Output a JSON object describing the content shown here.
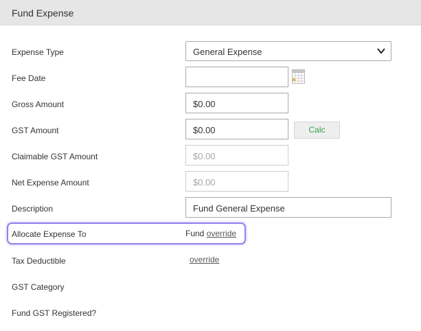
{
  "header": {
    "title": "Fund Expense"
  },
  "fields": {
    "expense_type": {
      "label": "Expense Type",
      "value": "General Expense"
    },
    "fee_date": {
      "label": "Fee Date",
      "value": ""
    },
    "gross_amount": {
      "label": "Gross Amount",
      "value": "$0.00"
    },
    "gst_amount": {
      "label": "GST Amount",
      "value": "$0.00",
      "calc_label": "Calc"
    },
    "claimable_gst_amount": {
      "label": "Claimable GST Amount",
      "value": "$0.00"
    },
    "net_expense_amount": {
      "label": "Net Expense Amount",
      "value": "$0.00"
    },
    "description": {
      "label": "Description",
      "value": "Fund General Expense"
    },
    "allocate_expense_to": {
      "label": "Allocate Expense To",
      "value": "Fund",
      "override_label": "override"
    },
    "tax_deductible": {
      "label": "Tax Deductible",
      "override_label": "override"
    },
    "gst_category": {
      "label": "GST Category"
    },
    "fund_gst_registered": {
      "label": "Fund GST Registered?"
    }
  },
  "icons": {
    "select_arrow": "chevron-down-icon",
    "calendar": "calendar-icon"
  },
  "colors": {
    "calc_text": "#2e9e4a",
    "highlight_border": "#8f82ea",
    "header_bg": "#e6e6e6"
  }
}
